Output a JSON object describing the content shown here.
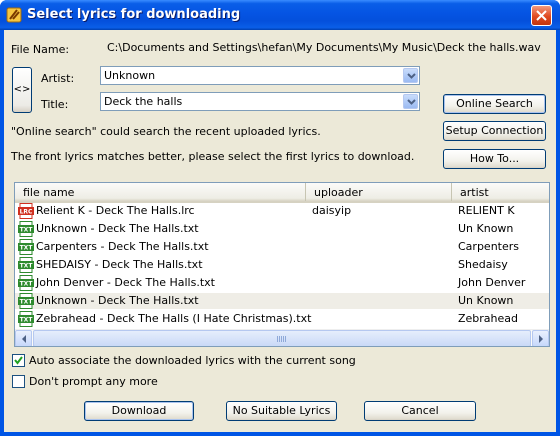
{
  "window": {
    "title": "Select lyrics for downloading"
  },
  "file_name": {
    "label": "File Name:",
    "value": "C:\\Documents and Settings\\hefan\\My Documents\\My Music\\Deck the halls.wav"
  },
  "swap_button_label": "<>",
  "artist": {
    "label": "Artist:",
    "value": "Unknown"
  },
  "title": {
    "label": "Title:",
    "value": "Deck the halls"
  },
  "info": {
    "line1": "\"Online search\" could search the recent uploaded lyrics.",
    "line2": "The front lyrics matches better, please select the first lyrics to download."
  },
  "buttons": {
    "online_search": "Online Search",
    "setup_connection": "Setup Connection",
    "how_to": "How To...",
    "download": "Download",
    "no_suitable": "No Suitable Lyrics",
    "cancel": "Cancel"
  },
  "list": {
    "columns": [
      "file name",
      "uploader",
      "artist"
    ],
    "rows": [
      {
        "icon": "lrc-file-icon",
        "badge": "LRC",
        "file": "Relient K - Deck The Halls.lrc",
        "uploader": "daisyip",
        "artist": "RELIENT K",
        "selected": false
      },
      {
        "icon": "txt-file-icon",
        "badge": "TXT",
        "file": "Unknown - Deck The Halls.txt",
        "uploader": "",
        "artist": "Un Known",
        "selected": false
      },
      {
        "icon": "txt-file-icon",
        "badge": "TXT",
        "file": "Carpenters - Deck The Halls.txt",
        "uploader": "",
        "artist": "Carpenters",
        "selected": false
      },
      {
        "icon": "txt-file-icon",
        "badge": "TXT",
        "file": "SHEDAISY - Deck The Halls.txt",
        "uploader": "",
        "artist": "Shedaisy",
        "selected": false
      },
      {
        "icon": "txt-file-icon",
        "badge": "TXT",
        "file": "John Denver - Deck The Halls.txt",
        "uploader": "",
        "artist": "John Denver",
        "selected": false
      },
      {
        "icon": "txt-file-icon",
        "badge": "TXT",
        "file": "Unknown - Deck The Halls.txt",
        "uploader": "",
        "artist": "Un Known",
        "selected": true
      },
      {
        "icon": "txt-file-icon",
        "badge": "TXT",
        "file": "Zebrahead - Deck The Halls (I Hate Christmas).txt",
        "uploader": "",
        "artist": "Zebrahead",
        "selected": false
      }
    ]
  },
  "options": {
    "auto_associate": {
      "label": "Auto associate the downloaded lyrics with the current song",
      "checked": true
    },
    "dont_prompt": {
      "label": "Don't prompt any more",
      "checked": false
    }
  },
  "colors": {
    "titlebar": "#0554e3",
    "dialog_bg": "#ece9d8",
    "lrc_badge": "#d03020",
    "txt_badge": "#2e8a2e"
  }
}
